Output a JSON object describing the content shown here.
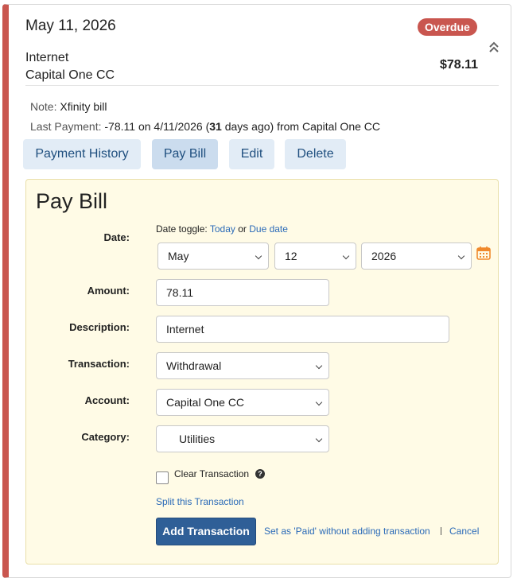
{
  "bill": {
    "due_date": "May 11, 2026",
    "status_badge": "Overdue",
    "payee": "Internet",
    "account": "Capital One CC",
    "amount": "$78.11",
    "note_label": "Note:",
    "note_value": "Xfinity bill",
    "last_payment_label": "Last Payment:",
    "last_payment_amount": "-78.11",
    "last_payment_on": "on",
    "last_payment_date": "4/11/2026",
    "last_payment_days": "31",
    "last_payment_days_suffix": "days ago)",
    "last_payment_from": "from Capital One CC"
  },
  "actions": {
    "payment_history": "Payment History",
    "pay_bill": "Pay Bill",
    "edit": "Edit",
    "delete": "Delete"
  },
  "pay_form": {
    "title": "Pay Bill",
    "date_label": "Date:",
    "date_toggle_prefix": "Date toggle:",
    "date_toggle_today": "Today",
    "date_toggle_or": "or",
    "date_toggle_due": "Due date",
    "month": "May",
    "day": "12",
    "year": "2026",
    "amount_label": "Amount:",
    "amount_value": "78.11",
    "description_label": "Description:",
    "description_value": "Internet",
    "transaction_label": "Transaction:",
    "transaction_value": "Withdrawal",
    "account_label": "Account:",
    "account_value": "Capital One CC",
    "category_label": "Category:",
    "category_value": "Utilities",
    "clear_transaction": "Clear Transaction",
    "split_link": "Split this Transaction",
    "add_button": "Add Transaction",
    "paid_link": "Set as 'Paid' without adding transaction",
    "cancel_link": "Cancel"
  },
  "colors": {
    "accent_overdue": "#c9564f",
    "primary_button": "#2f5f97",
    "secondary_button": "#e2ecf6",
    "link": "#2a6ab8",
    "panel_bg": "#fffbe6",
    "calendar_icon": "#f0892c"
  },
  "icons": {
    "collapse": "double-chevron-up-icon",
    "calendar": "calendar-icon",
    "help": "question-circle-icon",
    "dropdown": "chevron-down-icon"
  }
}
